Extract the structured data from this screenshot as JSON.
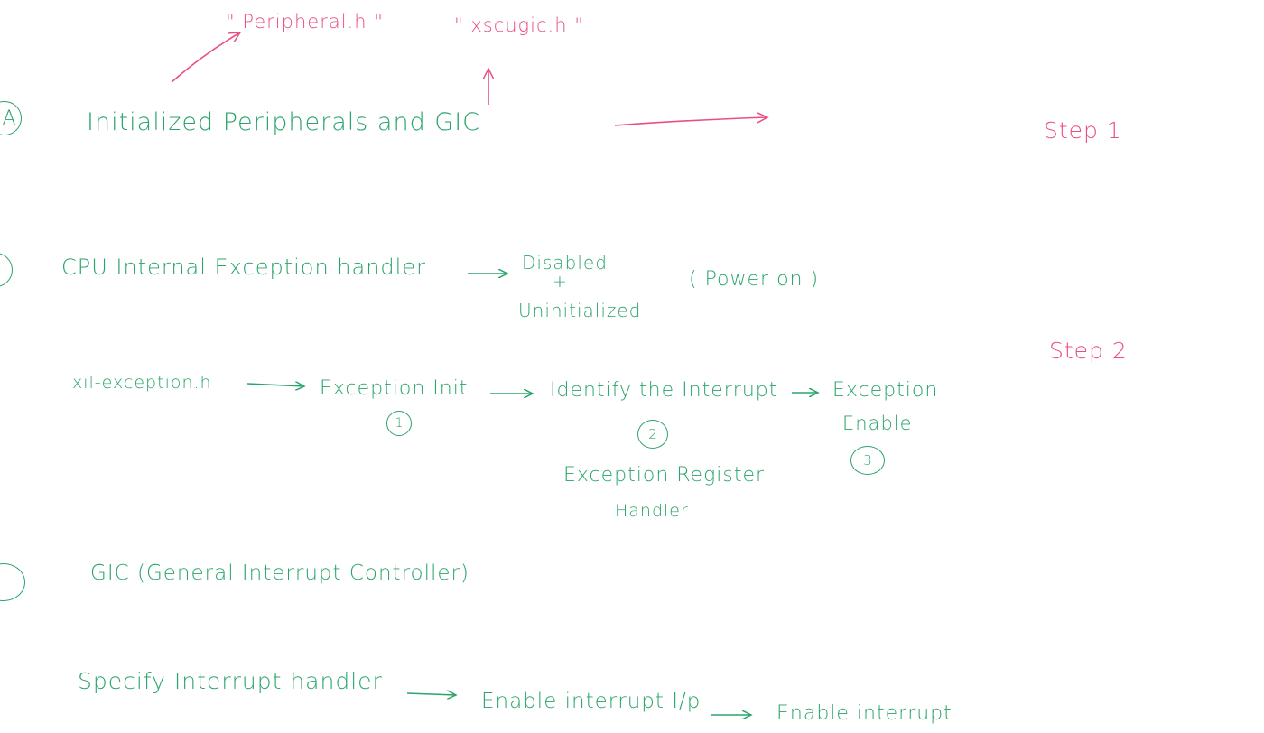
{
  "colors": {
    "note_green": "#2aa56a",
    "note_pink": "#ea4f7f",
    "background": "#ffffff"
  },
  "section_a": {
    "marker": "A",
    "title": "Initialized Peripherals and GIC",
    "ann_peripheral": "\" Peripheral.h \"",
    "ann_xscugic": "\" xscugic.h \"",
    "step": "Step 1"
  },
  "section_b": {
    "title": "CPU Internal Exception handler",
    "state_line1": "Disabled",
    "state_plus": "+",
    "state_line2": "Uninitialized",
    "power_note": "( Power on )",
    "step": "Step 2",
    "flow": {
      "source": "xil-exception.h",
      "item1": "Exception Init",
      "num1": "1",
      "item2": "Identify the Interrupt",
      "num2": "2",
      "item2_sub_line1": "Exception Register",
      "item2_sub_line2": "Handler",
      "item3_line1": "Exception",
      "item3_line2": "Enable",
      "num3": "3"
    }
  },
  "section_c": {
    "title": "GIC (General Interrupt Controller)",
    "flow": {
      "item1": "Specify Interrupt handler",
      "item2": "Enable interrupt I/p",
      "item3": "Enable interrupt"
    }
  }
}
